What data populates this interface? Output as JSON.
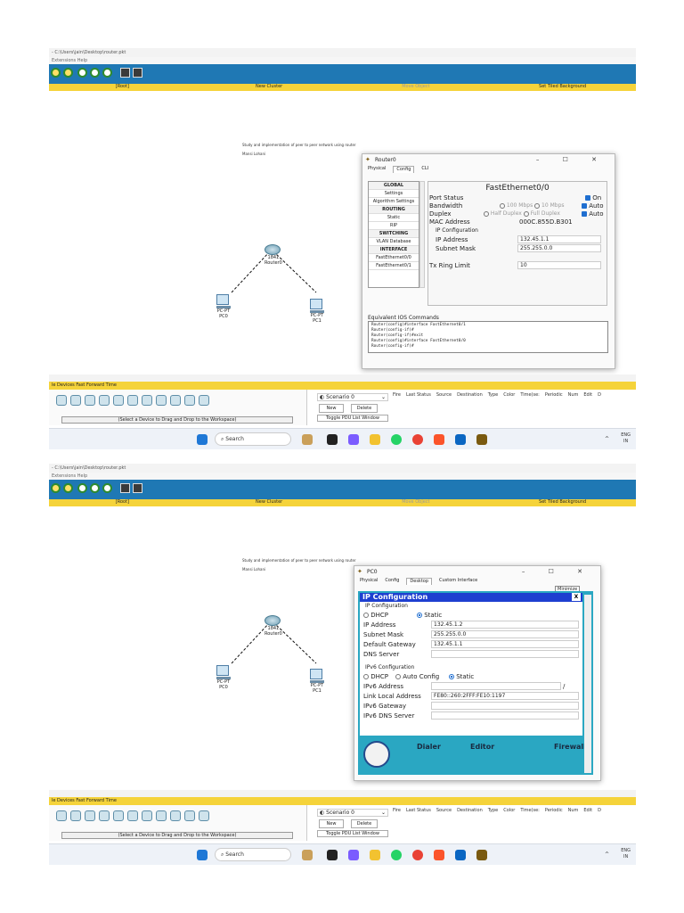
{
  "window": {
    "title_path": "- C:\\Users\\jain\\Desktop\\router.pkt",
    "menu_items": "Extensions   Help"
  },
  "yellowbar": {
    "root": "[Root]",
    "new_cluster": "New Cluster",
    "move_object": "Move Object",
    "set_tiled_bg": "Set Tiled Background"
  },
  "workspace": {
    "note_title": "Study and implementation of peer to peer network using router",
    "note_author": "Mansi Lohani",
    "router_model": "1841",
    "router_name": "Router0",
    "pc0_model": "PC-PT",
    "pc0_name": "PC0",
    "pc1_model": "PC-PT",
    "pc1_name": "PC1"
  },
  "bottom": {
    "devices_bar_1": "le Devices  Fast Forward Time",
    "devices_bar_2": "le Devices  Fast Forward Time",
    "select_hint": "(Select a Device to Drag and Drop to the Workspace)",
    "scenario": "Scenario 0",
    "new_btn": "New",
    "delete_btn": "Delete",
    "toggle_pdu": "Toggle PDU List Window",
    "pdu_headers": [
      "Fire",
      "Last Status",
      "Source",
      "Destination",
      "Type",
      "Color",
      "Time(se:",
      "Periodic",
      "Num",
      "Edit",
      "D"
    ]
  },
  "taskbar": {
    "search": "Search",
    "lang1": "ENG",
    "lang2": "IN",
    "caret": "^"
  },
  "router_dialog": {
    "title": "Router0",
    "tabs": [
      "Physical",
      "Config",
      "CLI"
    ],
    "left_items": [
      "GLOBAL",
      "Settings",
      "Algorithm Settings",
      "ROUTING",
      "Static",
      "RIP",
      "SWITCHING",
      "VLAN Database",
      "INTERFACE",
      "FastEthernet0/0",
      "FastEthernet0/1"
    ],
    "panel_title": "FastEthernet0/0",
    "port_status": "Port Status",
    "on": "On",
    "bandwidth": "Bandwidth",
    "bw_100": "100 Mbps",
    "bw_10": "10 Mbps",
    "auto": "Auto",
    "duplex": "Duplex",
    "half": "Half Duplex",
    "full": "Full Duplex",
    "mac_label": "MAC Address",
    "mac_value": "000C.855D.B301",
    "ip_cfg": "IP Configuration",
    "ip_label": "IP Address",
    "ip_value": "132.45.1.1",
    "mask_label": "Subnet Mask",
    "mask_value": "255.255.0.0",
    "tx_label": "Tx Ring Limit",
    "tx_value": "10",
    "ios_title": "Equivalent IOS Commands",
    "ios_lines": [
      "Router(config)#interface FastEthernet0/1",
      "Router(config-if)#",
      "Router(config-if)#exit",
      "Router(config)#interface FastEthernet0/0",
      "Router(config-if)#"
    ]
  },
  "pc_dialog": {
    "title": "PC0",
    "tabs": [
      "Physical",
      "Config",
      "Desktop",
      "Custom Interface"
    ],
    "minimize": "Minimize",
    "head": "IP Configuration",
    "close_x": "X",
    "sub": "IP Configuration",
    "dhcp": "DHCP",
    "static": "Static",
    "ip_label": "IP Address",
    "ip_value": "132.45.1.2",
    "mask_label": "Subnet Mask",
    "mask_value": "255.255.0.0",
    "gw_label": "Default Gateway",
    "gw_value": "132.45.1.1",
    "dns_label": "DNS Server",
    "ipv6_cfg": "IPv6 Configuration",
    "auto_cfg": "Auto Config",
    "ipv6_addr": "IPv6 Address",
    "ipv6_slash": "/",
    "link_local": "Link Local Address",
    "link_local_value": "FE80::260:2FFF:FE10:1197",
    "ipv6_gw": "IPv6 Gateway",
    "ipv6_dns": "IPv6 DNS Server",
    "dialer": "Dialer",
    "editor": "Editor",
    "firewall": "Firewall"
  }
}
